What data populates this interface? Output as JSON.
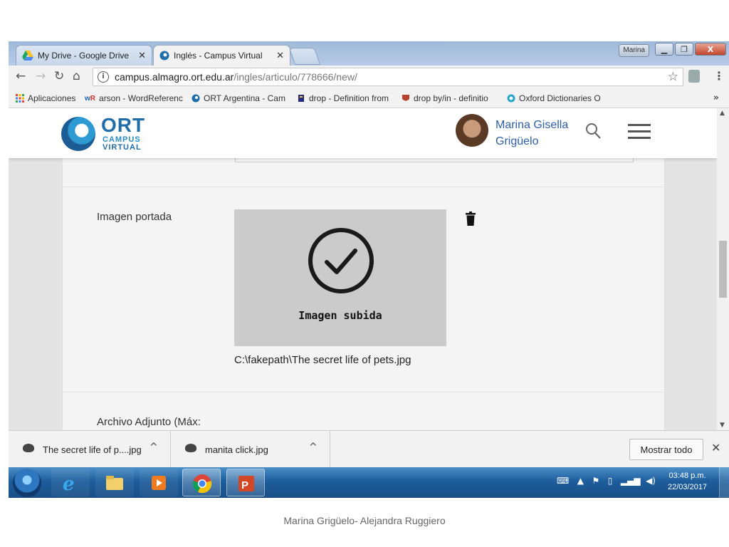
{
  "browser": {
    "tabs": [
      {
        "title": "My Drive - Google Drive",
        "active": false
      },
      {
        "title": "Inglés - Campus Virtual",
        "active": true
      }
    ],
    "profile_name": "Marina",
    "url_host": "campus.almagro.ort.edu.ar",
    "url_path": "/ingles/articulo/778666/new/",
    "bookmarks": [
      {
        "label": "Aplicaciones",
        "icon": "apps-grid-icon"
      },
      {
        "label": "arson - WordReferenc",
        "icon": "wordreference-icon"
      },
      {
        "label": "ORT Argentina - Cam",
        "icon": "ort-icon"
      },
      {
        "label": "drop - Definition from",
        "icon": "dictionary-icon"
      },
      {
        "label": "drop by/in - definitio",
        "icon": "cambridge-icon"
      },
      {
        "label": "Oxford Dictionaries O",
        "icon": "oxford-icon"
      }
    ],
    "bookmarks_overflow": "»"
  },
  "site": {
    "logo": {
      "name": "ORT",
      "line1": "CAMPUS",
      "line2": "VIRTUAL"
    },
    "user": {
      "first": "Marina Gisella",
      "last": "Grigüelo"
    }
  },
  "form": {
    "cover_label": "Imagen portada",
    "upload_status": "Imagen subida",
    "file_path": "C:\\fakepath\\The secret life of pets.jpg",
    "attachment_label": "Archivo Adjunto (Máx:"
  },
  "downloads": {
    "items": [
      {
        "name": "The secret life of p....jpg"
      },
      {
        "name": "manita click.jpg"
      }
    ],
    "show_all": "Mostrar todo",
    "close": "✕"
  },
  "taskbar": {
    "time": "03:48 p.m.",
    "date": "22/03/2017",
    "apps": [
      "internet-explorer",
      "file-explorer",
      "media-player",
      "chrome",
      "powerpoint"
    ]
  },
  "slide_footer": "Marina Grigüelo- Alejandra Ruggiero"
}
